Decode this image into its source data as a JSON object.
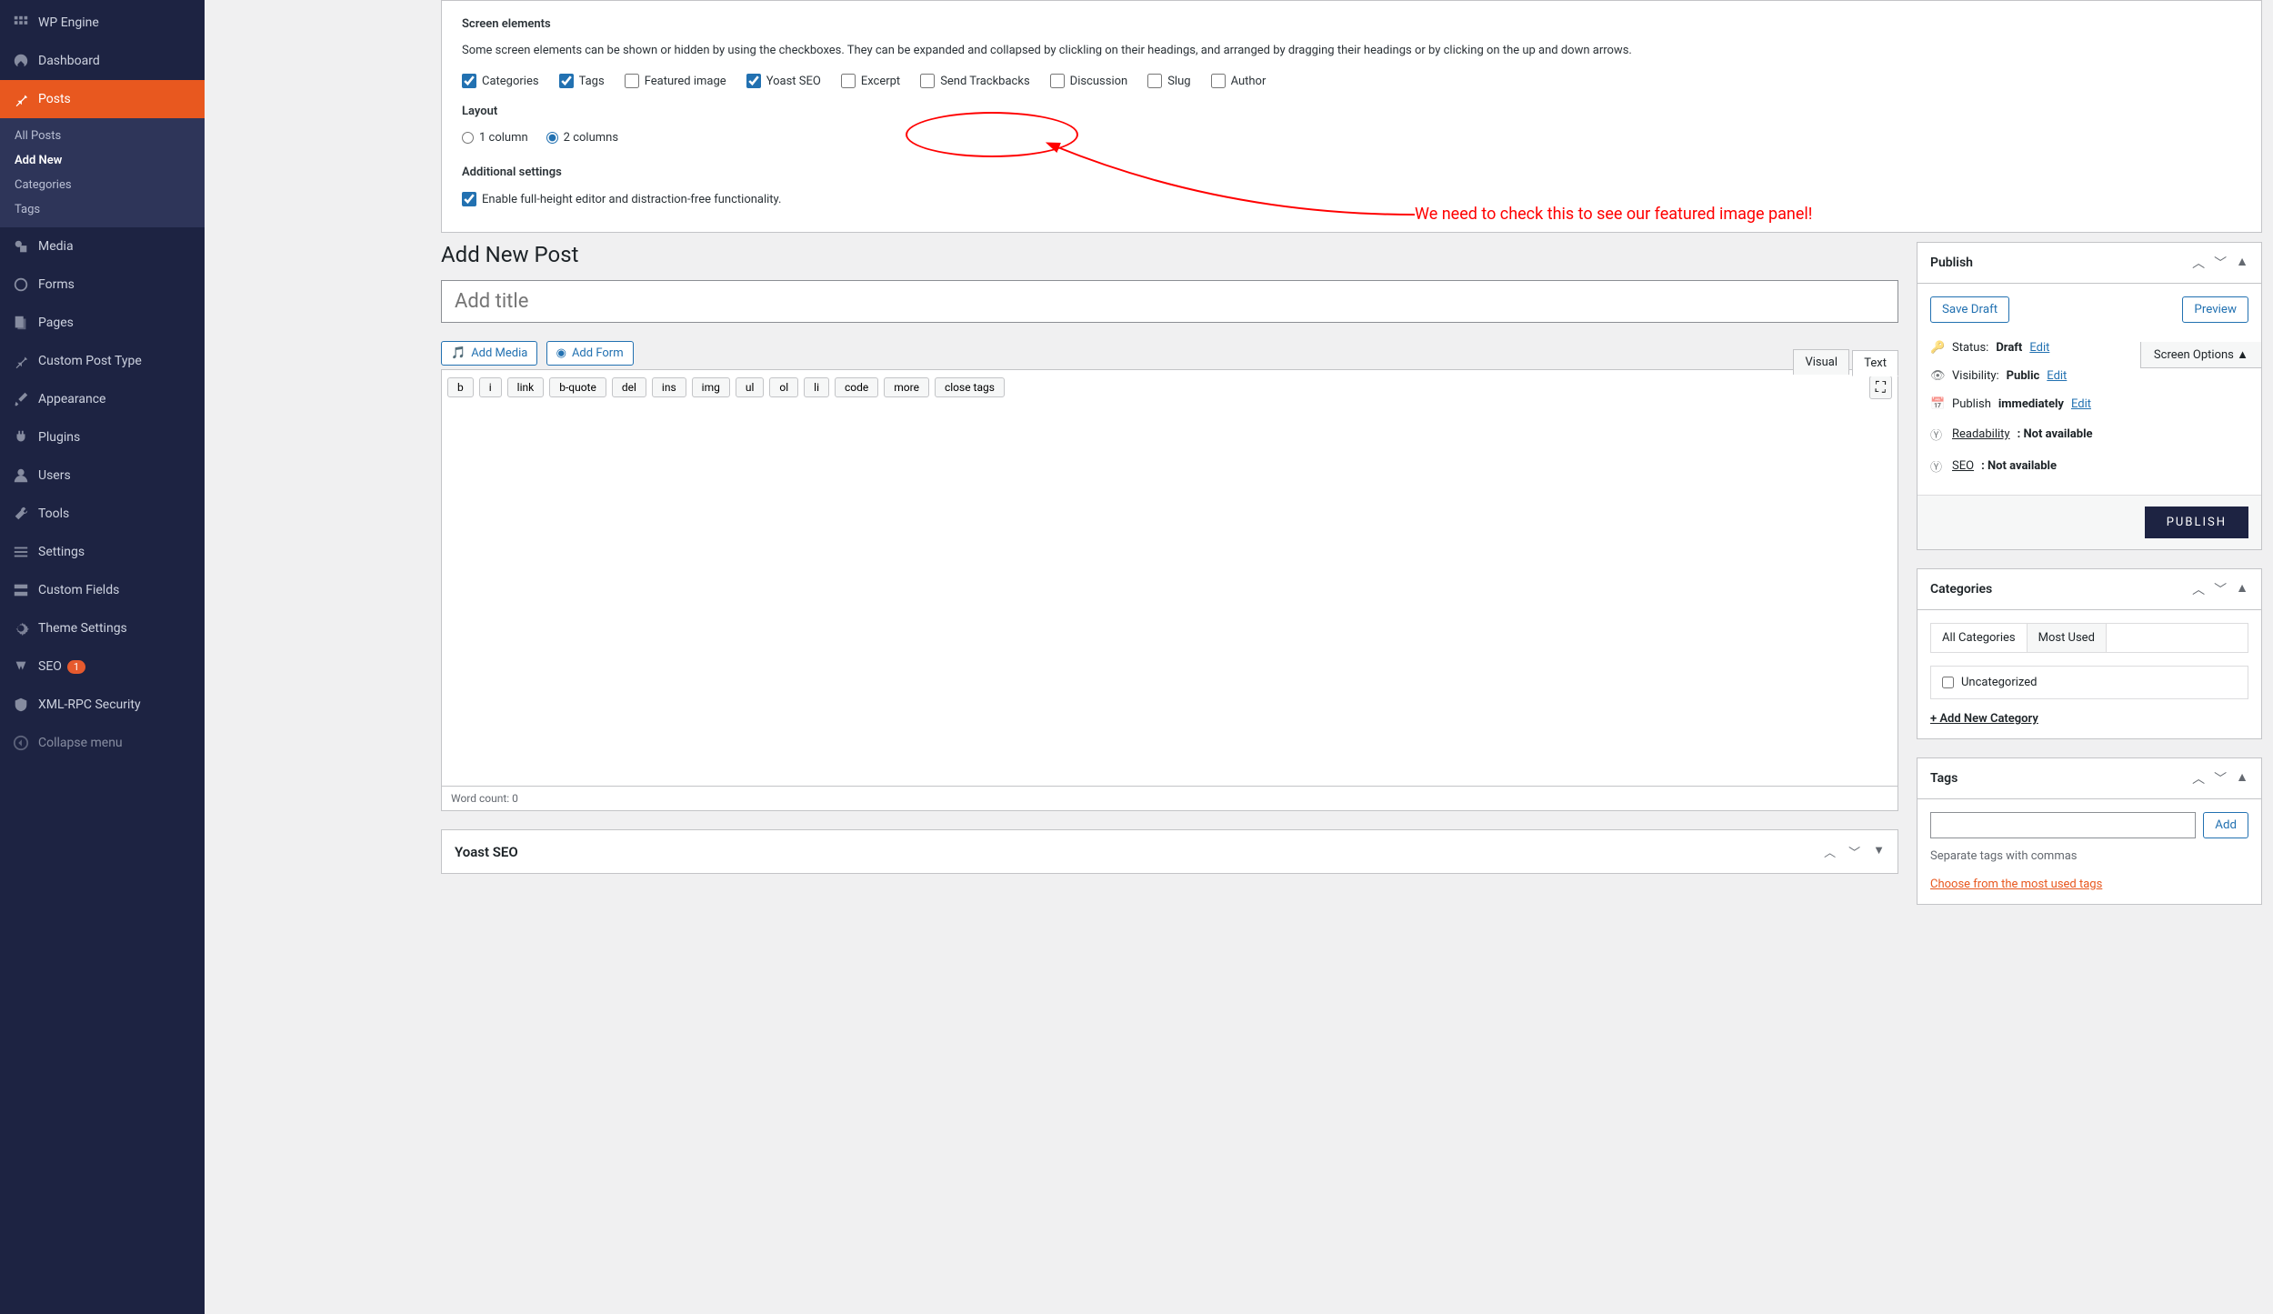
{
  "sidebar": {
    "items": [
      {
        "label": "WP Engine"
      },
      {
        "label": "Dashboard"
      },
      {
        "label": "Posts"
      },
      {
        "label": "Media"
      },
      {
        "label": "Forms"
      },
      {
        "label": "Pages"
      },
      {
        "label": "Custom Post Type"
      },
      {
        "label": "Appearance"
      },
      {
        "label": "Plugins"
      },
      {
        "label": "Users"
      },
      {
        "label": "Tools"
      },
      {
        "label": "Settings"
      },
      {
        "label": "Custom Fields"
      },
      {
        "label": "Theme Settings"
      },
      {
        "label": "SEO",
        "badge": "1"
      },
      {
        "label": "XML-RPC Security"
      },
      {
        "label": "Collapse menu"
      }
    ],
    "sub": [
      {
        "label": "All Posts"
      },
      {
        "label": "Add New"
      },
      {
        "label": "Categories"
      },
      {
        "label": "Tags"
      }
    ]
  },
  "screen_options": {
    "title": "Screen elements",
    "desc": "Some screen elements can be shown or hidden by using the checkboxes. They can be expanded and collapsed by clickling on their headings, and arranged by dragging their headings or by clicking on the up and down arrows.",
    "boxes": [
      {
        "label": "Categories",
        "checked": true
      },
      {
        "label": "Tags",
        "checked": true
      },
      {
        "label": "Featured image",
        "checked": false
      },
      {
        "label": "Yoast SEO",
        "checked": true
      },
      {
        "label": "Excerpt",
        "checked": false
      },
      {
        "label": "Send Trackbacks",
        "checked": false
      },
      {
        "label": "Discussion",
        "checked": false
      },
      {
        "label": "Slug",
        "checked": false
      },
      {
        "label": "Author",
        "checked": false
      }
    ],
    "layout_title": "Layout",
    "layouts": [
      {
        "label": "1 column",
        "checked": false
      },
      {
        "label": "2 columns",
        "checked": true
      }
    ],
    "additional_title": "Additional settings",
    "additional_label": "Enable full-height editor and distraction-free functionality.",
    "additional_checked": true,
    "tab": "Screen Options"
  },
  "annotation": "We need to check this to see our featured image panel!",
  "page": {
    "heading": "Add New Post",
    "title_placeholder": "Add title"
  },
  "editor": {
    "add_media": "Add Media",
    "add_form": "Add Form",
    "tabs": {
      "visual": "Visual",
      "text": "Text"
    },
    "qtags": [
      "b",
      "i",
      "link",
      "b-quote",
      "del",
      "ins",
      "img",
      "ul",
      "ol",
      "li",
      "code",
      "more",
      "close tags"
    ],
    "word_count": "Word count: 0"
  },
  "publish": {
    "title": "Publish",
    "save": "Save Draft",
    "preview": "Preview",
    "status_label": "Status:",
    "status_value": "Draft",
    "edit": "Edit",
    "vis_label": "Visibility:",
    "vis_value": "Public",
    "sched_label": "Publish",
    "sched_value": "immediately",
    "read_label": "Readability",
    "read_value": ": Not available",
    "seo_label": "SEO",
    "seo_value": ": Not available",
    "button": "PUBLISH"
  },
  "categories": {
    "title": "Categories",
    "tab1": "All Categories",
    "tab2": "Most Used",
    "uncat": "Uncategorized",
    "add": "+ Add New Category"
  },
  "tags": {
    "title": "Tags",
    "add": "Add",
    "hint": "Separate tags with commas",
    "link": "Choose from the most used tags"
  },
  "yoast": {
    "title": "Yoast SEO"
  }
}
